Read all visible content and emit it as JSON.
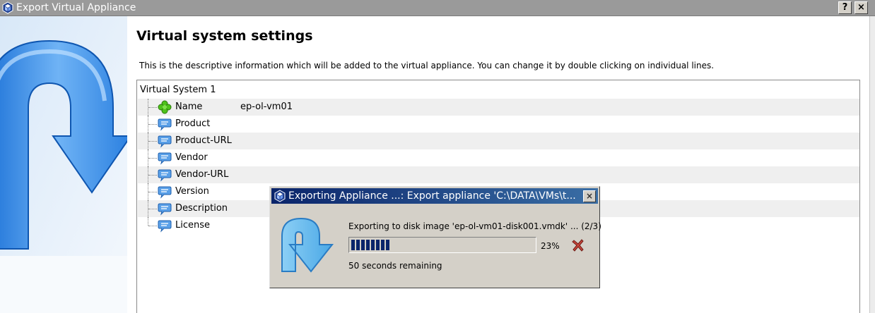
{
  "window": {
    "title": "Export Virtual Appliance",
    "help_button": "?",
    "close_button": "×"
  },
  "page": {
    "heading": "Virtual system settings",
    "description": "This is the descriptive information which will be added to the virtual appliance. You can change it by double clicking on individual lines."
  },
  "tree": {
    "root": "Virtual System 1",
    "items": [
      {
        "label": "Name",
        "value": "ep-ol-vm01",
        "icon": "name-icon"
      },
      {
        "label": "Product",
        "value": "",
        "icon": "description-icon"
      },
      {
        "label": "Product-URL",
        "value": "",
        "icon": "description-icon"
      },
      {
        "label": "Vendor",
        "value": "",
        "icon": "description-icon"
      },
      {
        "label": "Vendor-URL",
        "value": "",
        "icon": "description-icon"
      },
      {
        "label": "Version",
        "value": "",
        "icon": "description-icon"
      },
      {
        "label": "Description",
        "value": "",
        "icon": "description-icon"
      },
      {
        "label": "License",
        "value": "",
        "icon": "description-icon"
      }
    ]
  },
  "progress_dialog": {
    "title": "Exporting Appliance ...: Export appliance 'C:\\DATA\\VMs\\t...",
    "close_button": "×",
    "message": "Exporting to disk image 'ep-ol-vm01-disk001.vmdk' ... (2/3)",
    "percent_label": "23%",
    "progress": 0.23,
    "remaining": "50 seconds remaining"
  },
  "colors": {
    "title_bar": "#9a9a9a",
    "dialog_title": "#0a246a",
    "dialog_bg": "#d4d0c8",
    "progress_fill": "#0a246a",
    "alt_row": "#efefef"
  }
}
